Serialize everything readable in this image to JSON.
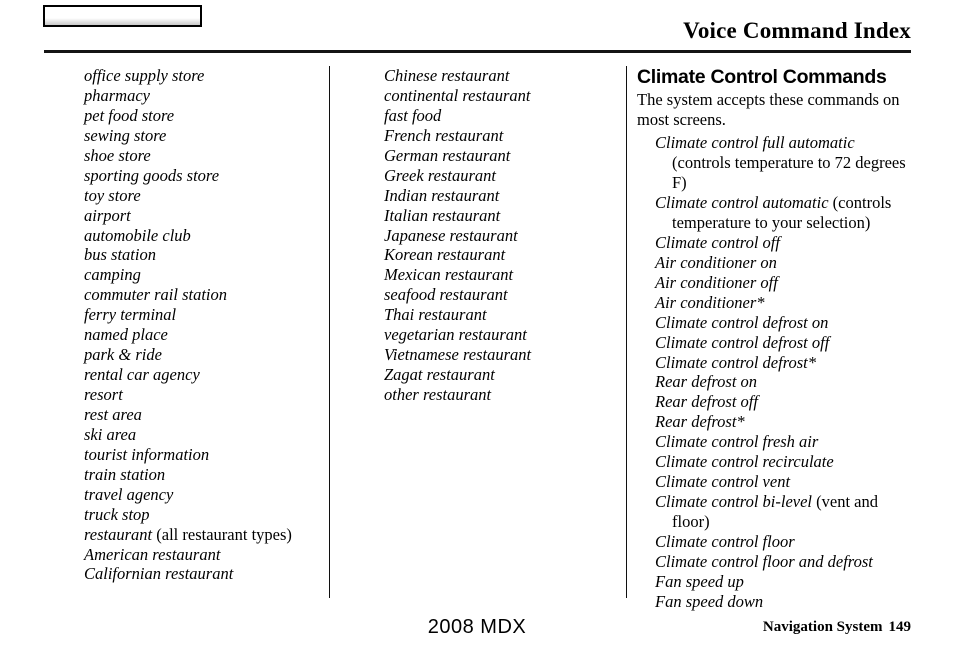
{
  "header": {
    "tab_label": "",
    "title": "Voice Command Index"
  },
  "columns": {
    "column_1": {
      "items": [
        {
          "text": "office supply store"
        },
        {
          "text": "pharmacy"
        },
        {
          "text": "pet food store"
        },
        {
          "text": "sewing store"
        },
        {
          "text": "shoe store"
        },
        {
          "text": "sporting goods store"
        },
        {
          "text": "toy store"
        },
        {
          "text": "airport"
        },
        {
          "text": "automobile club"
        },
        {
          "text": "bus station"
        },
        {
          "text": "camping"
        },
        {
          "text": "commuter rail station"
        },
        {
          "text": "ferry terminal"
        },
        {
          "text": "named place"
        },
        {
          "text": "park & ride"
        },
        {
          "text": "rental car agency"
        },
        {
          "text": "resort"
        },
        {
          "text": "rest area"
        },
        {
          "text": "ski area"
        },
        {
          "text": "tourist information"
        },
        {
          "text": "train station"
        },
        {
          "text": "travel agency"
        },
        {
          "text": "truck stop"
        },
        {
          "text": "restaurant",
          "note": " (all restaurant types)"
        },
        {
          "text": "American restaurant"
        },
        {
          "text": "Californian restaurant"
        }
      ]
    },
    "column_2": {
      "items": [
        {
          "text": "Chinese restaurant"
        },
        {
          "text": "continental restaurant"
        },
        {
          "text": "fast food"
        },
        {
          "text": "French restaurant"
        },
        {
          "text": "German restaurant"
        },
        {
          "text": "Greek restaurant"
        },
        {
          "text": "Indian restaurant"
        },
        {
          "text": "Italian restaurant"
        },
        {
          "text": "Japanese restaurant"
        },
        {
          "text": "Korean restaurant"
        },
        {
          "text": "Mexican restaurant"
        },
        {
          "text": "seafood restaurant"
        },
        {
          "text": "Thai restaurant"
        },
        {
          "text": "vegetarian restaurant"
        },
        {
          "text": "Vietnamese restaurant"
        },
        {
          "text": "Zagat restaurant"
        },
        {
          "text": "other restaurant"
        }
      ]
    },
    "column_3": {
      "heading": "Climate Control Commands",
      "intro": "The system accepts these commands on most screens.",
      "items": [
        {
          "text": "Climate control full automatic",
          "note": " (controls temperature to 72 degrees F)"
        },
        {
          "text": "Climate control automatic",
          "note": " (controls temperature to your selection)"
        },
        {
          "text": "Climate control off"
        },
        {
          "text": "Air conditioner on"
        },
        {
          "text": "Air conditioner off"
        },
        {
          "text": "Air conditioner*"
        },
        {
          "text": "Climate control defrost on"
        },
        {
          "text": "Climate control defrost off"
        },
        {
          "text": "Climate control defrost*"
        },
        {
          "text": "Rear defrost on"
        },
        {
          "text": "Rear defrost off"
        },
        {
          "text": "Rear defrost*"
        },
        {
          "text": "Climate control fresh air"
        },
        {
          "text": "Climate control recirculate"
        },
        {
          "text": "Climate control vent"
        },
        {
          "text": "Climate control bi-level",
          "note": " (vent and floor)"
        },
        {
          "text": "Climate control floor"
        },
        {
          "text": "Climate control floor and defrost"
        },
        {
          "text": "Fan speed up"
        },
        {
          "text": "Fan speed down"
        }
      ]
    }
  },
  "footer": {
    "model": "2008  MDX",
    "section": "Navigation System",
    "page_number": "149"
  }
}
